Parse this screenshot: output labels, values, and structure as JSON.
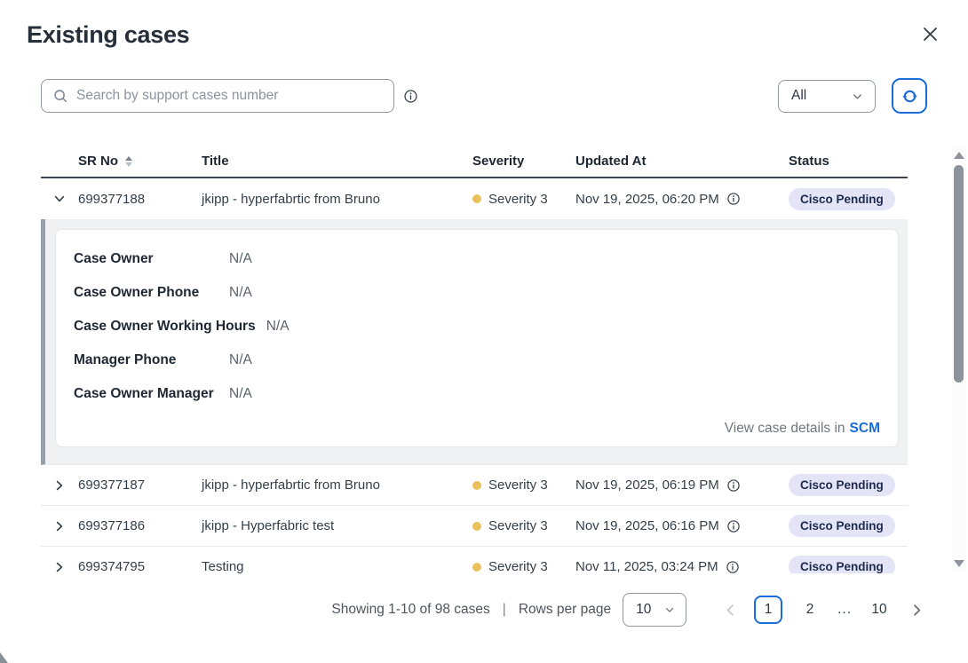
{
  "modal": {
    "title": "Existing cases"
  },
  "toolbar": {
    "search_placeholder": "Search by support cases number",
    "filter_selected": "All"
  },
  "table": {
    "columns": [
      "SR No",
      "Title",
      "Severity",
      "Updated At",
      "Status"
    ],
    "rows": [
      {
        "sr_no": "699377188",
        "title": "jkipp - hyperfabrtic from Bruno",
        "severity": "Severity 3",
        "updated_at": "Nov 19, 2025, 06:20 PM",
        "status": "Cisco Pending",
        "expanded": true
      },
      {
        "sr_no": "699377187",
        "title": "jkipp - hyperfabrtic from Bruno",
        "severity": "Severity 3",
        "updated_at": "Nov 19, 2025, 06:19 PM",
        "status": "Cisco Pending",
        "expanded": false
      },
      {
        "sr_no": "699377186",
        "title": "jkipp - Hyperfabric test",
        "severity": "Severity 3",
        "updated_at": "Nov 19, 2025, 06:16 PM",
        "status": "Cisco Pending",
        "expanded": false
      },
      {
        "sr_no": "699374795",
        "title": "Testing",
        "severity": "Severity 3",
        "updated_at": "Nov 11, 2025, 03:24 PM",
        "status": "Cisco Pending",
        "expanded": false
      }
    ],
    "expanded_details": {
      "fields": [
        {
          "label": "Case Owner",
          "value": "N/A"
        },
        {
          "label": "Case Owner Phone",
          "value": "N/A"
        },
        {
          "label": "Case Owner Working Hours",
          "value": "N/A"
        },
        {
          "label": "Manager Phone",
          "value": "N/A"
        },
        {
          "label": "Case Owner Manager",
          "value": "N/A"
        }
      ],
      "link_prefix": "View case details in",
      "link_label": "SCM"
    }
  },
  "pagination": {
    "summary": "Showing 1-10 of 98 cases",
    "separator": "|",
    "rows_per_page_label": "Rows per page",
    "rows_per_page_value": "10",
    "pages": [
      "1",
      "2",
      "...",
      "10"
    ],
    "current_page": "1"
  },
  "icons": {
    "search": "magnifier",
    "info": "circled-i",
    "close": "✕",
    "chevron_down": "∨",
    "chevron_right": "›",
    "sort": "▲▼",
    "refresh": "⟳",
    "dropdown_chevron": "∨",
    "prev_page": "‹",
    "next_page": "›",
    "scroll_up": "▲",
    "scroll_down": "▼"
  },
  "colors": {
    "accent_blue": "#1A6CD8",
    "severity_yellow": "#E9C15E",
    "badge_background": "#E4E4F7",
    "badge_text": "#1D2A4D",
    "header_underline": "#3D4654",
    "expanded_background": "#EFF1F3",
    "expanded_strip": "#9AA0A8"
  }
}
